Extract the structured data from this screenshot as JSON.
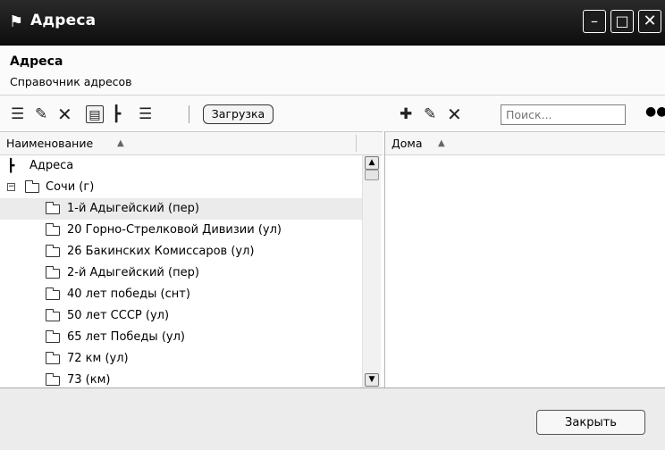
{
  "window": {
    "title": "Адреса",
    "app_icon": "map-marker-icon"
  },
  "header": {
    "title": "Адреса",
    "subtitle": "Справочник адресов"
  },
  "toolbar": {
    "load_label": "Загрузка",
    "search_placeholder": "Поиск...",
    "icons": [
      "add-tree-icon",
      "edit-icon",
      "delete-icon",
      "list-view-icon",
      "tree-view-icon",
      "flat-list-icon",
      "add-icon",
      "edit-icon",
      "delete-icon",
      "binoculars-icon"
    ]
  },
  "left_panel": {
    "column_header": "Наименование",
    "tree": [
      {
        "label": "Адреса",
        "level": 0,
        "type": "root"
      },
      {
        "label": "Сочи (г)",
        "level": 1,
        "type": "folder",
        "expanded": true
      },
      {
        "label": "1-й Адыгейский (пер)",
        "level": 2,
        "type": "folder",
        "selected": true
      },
      {
        "label": "20 Горно-Стрелковой Дивизии (ул)",
        "level": 2,
        "type": "folder"
      },
      {
        "label": "26 Бакинских Комиссаров (ул)",
        "level": 2,
        "type": "folder"
      },
      {
        "label": "2-й Адыгейский (пер)",
        "level": 2,
        "type": "folder"
      },
      {
        "label": "40 лет победы (снт)",
        "level": 2,
        "type": "folder"
      },
      {
        "label": "50 лет СССР (ул)",
        "level": 2,
        "type": "folder"
      },
      {
        "label": "65 лет Победы (ул)",
        "level": 2,
        "type": "folder"
      },
      {
        "label": "72 км (ул)",
        "level": 2,
        "type": "folder"
      },
      {
        "label": "73 (км)",
        "level": 2,
        "type": "folder"
      }
    ]
  },
  "right_panel": {
    "column_header": "Дома"
  },
  "footer": {
    "close_label": "Закрыть"
  }
}
